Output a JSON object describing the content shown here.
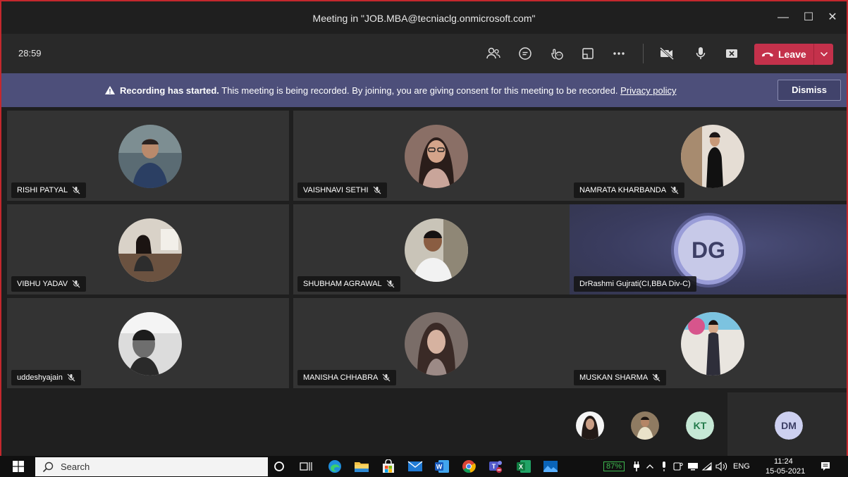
{
  "window": {
    "title": "Meeting in \"JOB.MBA@tecniaclg.onmicrosoft.com\"",
    "minimize": "—",
    "maximize": "☐",
    "close": "✕"
  },
  "toolbar": {
    "timer": "28:59",
    "leave_label": "Leave",
    "icons": [
      "participants-icon",
      "chat-icon",
      "reactions-icon",
      "share-tray-icon",
      "more-actions-icon",
      "camera-off-icon",
      "microphone-icon",
      "share-screen-icon"
    ]
  },
  "banner": {
    "bold_text": "Recording has started.",
    "text": " This meeting is being recorded. By joining, you are giving consent for this meeting to be recorded. ",
    "link": "Privacy policy",
    "dismiss_label": "Dismiss"
  },
  "participants": [
    {
      "name": "RISHI PATYAL",
      "muted": true
    },
    {
      "name": "VAISHNAVI SETHI",
      "muted": true
    },
    {
      "name": "NAMRATA KHARBANDA",
      "muted": true
    },
    {
      "name": "VIBHU YADAV",
      "muted": true
    },
    {
      "name": "SHUBHAM AGRAWAL",
      "muted": true
    },
    {
      "name": "DrRashmi Gujrati(CI,BBA Div-C)",
      "initials": "DG",
      "active_speaker": true
    },
    {
      "name": "uddeshyajain",
      "muted": true
    },
    {
      "name": "MANISHA CHHABRA",
      "muted": true
    },
    {
      "name": "MUSKAN SHARMA",
      "muted": true
    }
  ],
  "overflow": {
    "kt_initials": "KT",
    "dm_initials": "DM"
  },
  "taskbar": {
    "search_placeholder": "Search",
    "battery": "87%",
    "language": "ENG",
    "time": "11:24",
    "date": "15-05-2021"
  },
  "colors": {
    "leave": "#c4314b",
    "banner": "#4d4f7a",
    "kt_avatar": "#c5e8d5",
    "dm_avatar": "#cdd0f0",
    "battery": "#3fb950"
  }
}
